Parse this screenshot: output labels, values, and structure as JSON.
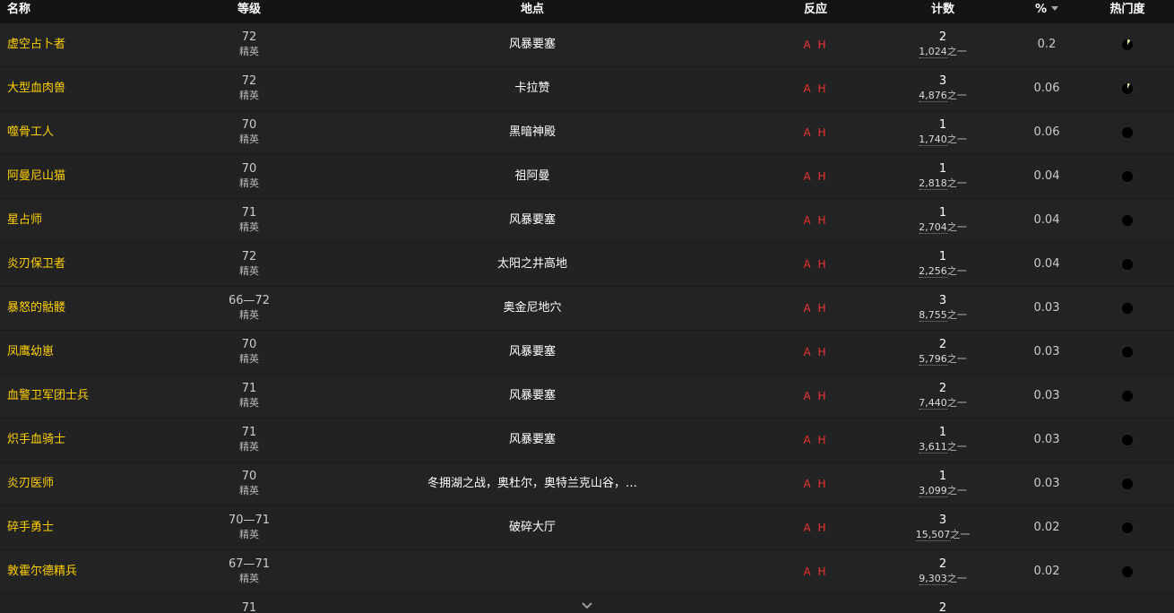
{
  "columns": {
    "name": "名称",
    "level": "等级",
    "location": "地点",
    "react": "反应",
    "count": "计数",
    "percent": "%",
    "popularity": "热门度"
  },
  "rows": [
    {
      "name": "虚空占卜者",
      "level": "72",
      "classification": "精英",
      "location": "风暴要塞",
      "react": "A H",
      "count": "2",
      "total": "1,024",
      "of_suffix": "之一",
      "percent": "0.2",
      "popularity": 0.1
    },
    {
      "name": "大型血肉兽",
      "level": "72",
      "classification": "精英",
      "location": "卡拉赞",
      "react": "A H",
      "count": "3",
      "total": "4,876",
      "of_suffix": "之一",
      "percent": "0.06",
      "popularity": 0.08
    },
    {
      "name": "噬骨工人",
      "level": "70",
      "classification": "精英",
      "location": "黑暗神殿",
      "react": "A H",
      "count": "1",
      "total": "1,740",
      "of_suffix": "之一",
      "percent": "0.06",
      "popularity": 0
    },
    {
      "name": "阿曼尼山猫",
      "level": "70",
      "classification": "精英",
      "location": "祖阿曼",
      "react": "A H",
      "count": "1",
      "total": "2,818",
      "of_suffix": "之一",
      "percent": "0.04",
      "popularity": 0
    },
    {
      "name": "星占师",
      "level": "71",
      "classification": "精英",
      "location": "风暴要塞",
      "react": "A H",
      "count": "1",
      "total": "2,704",
      "of_suffix": "之一",
      "percent": "0.04",
      "popularity": 0
    },
    {
      "name": "炎刃保卫者",
      "level": "72",
      "classification": "精英",
      "location": "太阳之井高地",
      "react": "A H",
      "count": "1",
      "total": "2,256",
      "of_suffix": "之一",
      "percent": "0.04",
      "popularity": 0
    },
    {
      "name": "暴怒的骷髅",
      "level": "66—72",
      "classification": "精英",
      "location": "奥金尼地穴",
      "react": "A H",
      "count": "3",
      "total": "8,755",
      "of_suffix": "之一",
      "percent": "0.03",
      "popularity": 0
    },
    {
      "name": "凤鹰幼崽",
      "level": "70",
      "classification": "精英",
      "location": "风暴要塞",
      "react": "A H",
      "count": "2",
      "total": "5,796",
      "of_suffix": "之一",
      "percent": "0.03",
      "popularity": 0
    },
    {
      "name": "血警卫军团士兵",
      "level": "71",
      "classification": "精英",
      "location": "风暴要塞",
      "react": "A H",
      "count": "2",
      "total": "7,440",
      "of_suffix": "之一",
      "percent": "0.03",
      "popularity": 0
    },
    {
      "name": "炽手血骑士",
      "level": "71",
      "classification": "精英",
      "location": "风暴要塞",
      "react": "A H",
      "count": "1",
      "total": "3,611",
      "of_suffix": "之一",
      "percent": "0.03",
      "popularity": 0
    },
    {
      "name": "炎刃医师",
      "level": "70",
      "classification": "精英",
      "location": "冬拥湖之战，奥杜尔，奥特兰克山谷，…",
      "react": "A H",
      "count": "1",
      "total": "3,099",
      "of_suffix": "之一",
      "percent": "0.03",
      "popularity": 0
    },
    {
      "name": "碎手勇士",
      "level": "70—71",
      "classification": "精英",
      "location": "破碎大厅",
      "react": "A H",
      "count": "3",
      "total": "15,507",
      "of_suffix": "之一",
      "percent": "0.02",
      "popularity": 0
    },
    {
      "name": "敦霍尔德精兵",
      "level": "67—71",
      "classification": "精英",
      "location": "",
      "react": "A H",
      "count": "2",
      "total": "9,303",
      "of_suffix": "之一",
      "percent": "0.02",
      "popularity": 0
    }
  ],
  "partial_row": {
    "level": "71",
    "count": "2"
  },
  "colors": {
    "name": "#ffd100",
    "react": "#ee3333",
    "pie_fill": "#e8e6a0",
    "pie_bg": "#000000"
  }
}
